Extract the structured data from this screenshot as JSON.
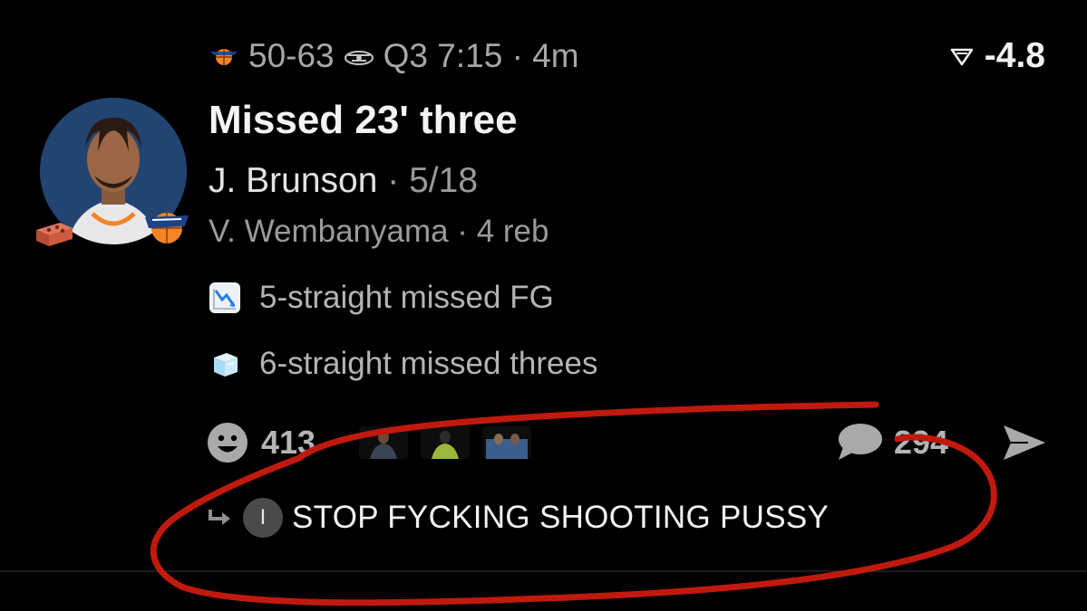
{
  "header": {
    "home_team_icon": "knicks-basketball-icon",
    "score": "50-63",
    "away_team_icon": "spurs-spur-icon",
    "clock": "Q3 7:15 · 4m",
    "spread_icon": "funnel-down-icon",
    "spread": "-4.8"
  },
  "play": {
    "title": "Missed 23' three",
    "shooter": "J. Brunson",
    "shooter_stat": "· 5/18",
    "rebounder_line": "V. Wembanyama · 4 reb",
    "avatar_badge_icon": "brick-icon",
    "team_badge_icon": "knicks-logo-icon"
  },
  "streaks": [
    {
      "icon": "chart-decreasing-icon",
      "label": "5-straight missed FG"
    },
    {
      "icon": "ice-cube-icon",
      "label": "6-straight missed threes"
    }
  ],
  "reactions": {
    "icon": "smiley-icon",
    "count": "413",
    "comment_count": "294",
    "comment_icon": "speech-bubble-icon",
    "send_icon": "send-arrow-icon"
  },
  "reply": {
    "avatar_letter": "I",
    "text": "STOP FYCKING SHOOTING PUSSY"
  },
  "colors": {
    "background": "#000000",
    "annotation": "#c0190e",
    "muted_text": "#a7a7a7"
  }
}
